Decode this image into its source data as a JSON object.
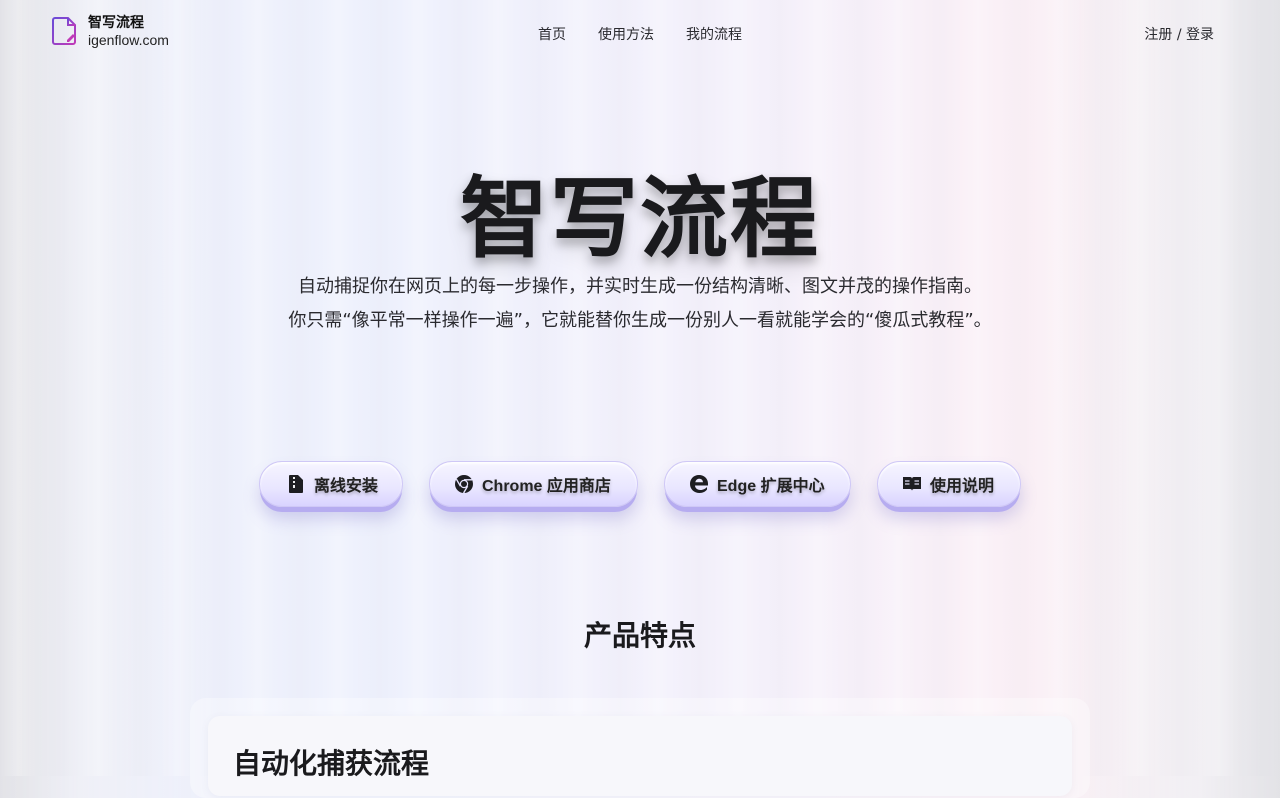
{
  "brand": {
    "name": "智写流程",
    "domain": "igenflow.com",
    "icon": "document-edit-icon"
  },
  "nav": {
    "items": [
      "首页",
      "使用方法",
      "我的流程"
    ],
    "login": "注册 / 登录"
  },
  "hero": {
    "title": "智写流程",
    "lines": [
      "自动捕捉你在网页上的每一步操作，并实时生成一份结构清晰、图文并茂的操作指南。",
      "你只需“像平常一样操作一遍”，它就能替你生成一份别人一看就能学会的“傻瓜式教程”。"
    ]
  },
  "buttons": [
    {
      "label": "离线安装",
      "icon": "zip-file-icon"
    },
    {
      "label": "Chrome 应用商店",
      "icon": "chrome-icon"
    },
    {
      "label": "Edge 扩展中心",
      "icon": "edge-icon"
    },
    {
      "label": "使用说明",
      "icon": "book-icon"
    }
  ],
  "features": {
    "title": "产品特点",
    "cards": [
      {
        "title": "自动化捕获流程"
      }
    ]
  },
  "colors": {
    "accent": "#b6acf0",
    "button_bg": "#e9e6ff",
    "brand_icon": "#8b3fd0"
  }
}
